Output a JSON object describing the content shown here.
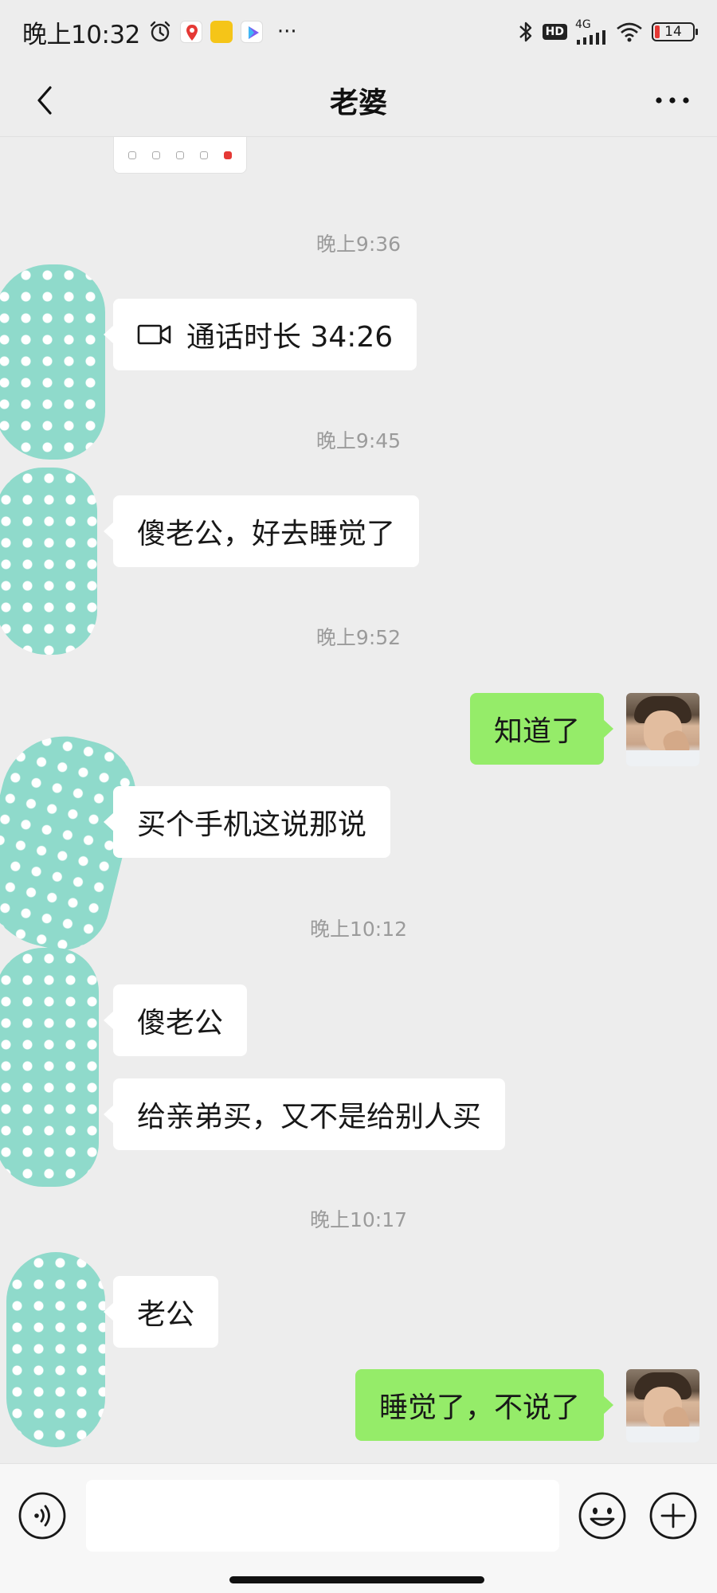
{
  "status_bar": {
    "time": "晚上10:32",
    "overflow": "···",
    "network": "4G",
    "hd_badge": "HD",
    "battery": "14"
  },
  "header": {
    "title": "老婆",
    "back_icon": "chevron-left-icon",
    "more_icon": "more-horizontal-icon"
  },
  "messages": {
    "t1": "晚上9:36",
    "call_text": "通话时长 34:26",
    "t2": "晚上9:45",
    "m1": "傻老公，好去睡觉了",
    "t3": "晚上9:52",
    "m2": "知道了",
    "m3": "买个手机这说那说",
    "t4": "晚上10:12",
    "m4": "傻老公",
    "m5": "给亲弟买，又不是给别人买",
    "t5": "晚上10:17",
    "m6": "老公",
    "m7": "睡觉了，不说了"
  },
  "input_bar": {
    "voice_icon": "voice-icon",
    "emoji_icon": "emoji-icon",
    "plus_icon": "plus-icon",
    "text_value": ""
  },
  "colors": {
    "background": "#ededed",
    "outgoing_bubble": "#95ec69",
    "incoming_bubble": "#ffffff",
    "timestamp": "#9b9b9b",
    "avatar_teal": "#8fdacb"
  }
}
